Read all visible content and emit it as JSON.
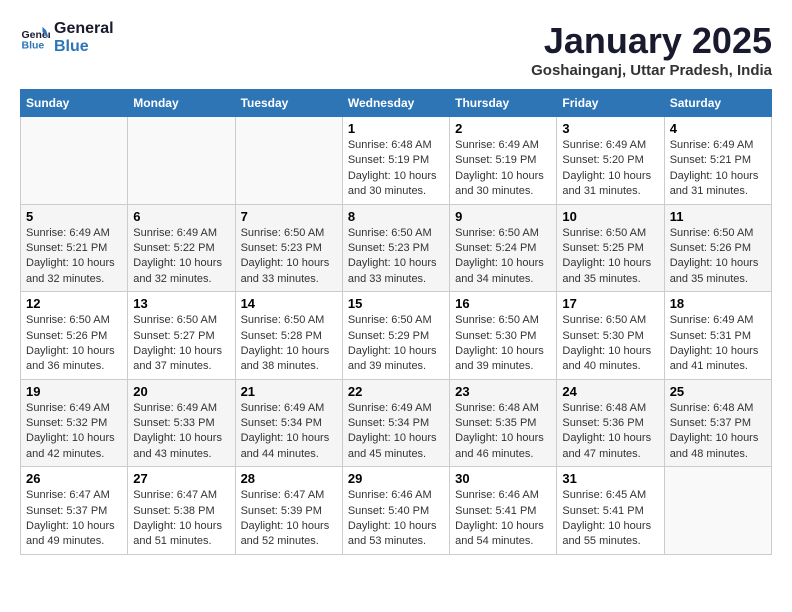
{
  "logo": {
    "line1": "General",
    "line2": "Blue"
  },
  "title": "January 2025",
  "subtitle": "Goshainganj, Uttar Pradesh, India",
  "days_of_week": [
    "Sunday",
    "Monday",
    "Tuesday",
    "Wednesday",
    "Thursday",
    "Friday",
    "Saturday"
  ],
  "weeks": [
    [
      {
        "day": "",
        "info": ""
      },
      {
        "day": "",
        "info": ""
      },
      {
        "day": "",
        "info": ""
      },
      {
        "day": "1",
        "info": "Sunrise: 6:48 AM\nSunset: 5:19 PM\nDaylight: 10 hours and 30 minutes."
      },
      {
        "day": "2",
        "info": "Sunrise: 6:49 AM\nSunset: 5:19 PM\nDaylight: 10 hours and 30 minutes."
      },
      {
        "day": "3",
        "info": "Sunrise: 6:49 AM\nSunset: 5:20 PM\nDaylight: 10 hours and 31 minutes."
      },
      {
        "day": "4",
        "info": "Sunrise: 6:49 AM\nSunset: 5:21 PM\nDaylight: 10 hours and 31 minutes."
      }
    ],
    [
      {
        "day": "5",
        "info": "Sunrise: 6:49 AM\nSunset: 5:21 PM\nDaylight: 10 hours and 32 minutes."
      },
      {
        "day": "6",
        "info": "Sunrise: 6:49 AM\nSunset: 5:22 PM\nDaylight: 10 hours and 32 minutes."
      },
      {
        "day": "7",
        "info": "Sunrise: 6:50 AM\nSunset: 5:23 PM\nDaylight: 10 hours and 33 minutes."
      },
      {
        "day": "8",
        "info": "Sunrise: 6:50 AM\nSunset: 5:23 PM\nDaylight: 10 hours and 33 minutes."
      },
      {
        "day": "9",
        "info": "Sunrise: 6:50 AM\nSunset: 5:24 PM\nDaylight: 10 hours and 34 minutes."
      },
      {
        "day": "10",
        "info": "Sunrise: 6:50 AM\nSunset: 5:25 PM\nDaylight: 10 hours and 35 minutes."
      },
      {
        "day": "11",
        "info": "Sunrise: 6:50 AM\nSunset: 5:26 PM\nDaylight: 10 hours and 35 minutes."
      }
    ],
    [
      {
        "day": "12",
        "info": "Sunrise: 6:50 AM\nSunset: 5:26 PM\nDaylight: 10 hours and 36 minutes."
      },
      {
        "day": "13",
        "info": "Sunrise: 6:50 AM\nSunset: 5:27 PM\nDaylight: 10 hours and 37 minutes."
      },
      {
        "day": "14",
        "info": "Sunrise: 6:50 AM\nSunset: 5:28 PM\nDaylight: 10 hours and 38 minutes."
      },
      {
        "day": "15",
        "info": "Sunrise: 6:50 AM\nSunset: 5:29 PM\nDaylight: 10 hours and 39 minutes."
      },
      {
        "day": "16",
        "info": "Sunrise: 6:50 AM\nSunset: 5:30 PM\nDaylight: 10 hours and 39 minutes."
      },
      {
        "day": "17",
        "info": "Sunrise: 6:50 AM\nSunset: 5:30 PM\nDaylight: 10 hours and 40 minutes."
      },
      {
        "day": "18",
        "info": "Sunrise: 6:49 AM\nSunset: 5:31 PM\nDaylight: 10 hours and 41 minutes."
      }
    ],
    [
      {
        "day": "19",
        "info": "Sunrise: 6:49 AM\nSunset: 5:32 PM\nDaylight: 10 hours and 42 minutes."
      },
      {
        "day": "20",
        "info": "Sunrise: 6:49 AM\nSunset: 5:33 PM\nDaylight: 10 hours and 43 minutes."
      },
      {
        "day": "21",
        "info": "Sunrise: 6:49 AM\nSunset: 5:34 PM\nDaylight: 10 hours and 44 minutes."
      },
      {
        "day": "22",
        "info": "Sunrise: 6:49 AM\nSunset: 5:34 PM\nDaylight: 10 hours and 45 minutes."
      },
      {
        "day": "23",
        "info": "Sunrise: 6:48 AM\nSunset: 5:35 PM\nDaylight: 10 hours and 46 minutes."
      },
      {
        "day": "24",
        "info": "Sunrise: 6:48 AM\nSunset: 5:36 PM\nDaylight: 10 hours and 47 minutes."
      },
      {
        "day": "25",
        "info": "Sunrise: 6:48 AM\nSunset: 5:37 PM\nDaylight: 10 hours and 48 minutes."
      }
    ],
    [
      {
        "day": "26",
        "info": "Sunrise: 6:47 AM\nSunset: 5:37 PM\nDaylight: 10 hours and 49 minutes."
      },
      {
        "day": "27",
        "info": "Sunrise: 6:47 AM\nSunset: 5:38 PM\nDaylight: 10 hours and 51 minutes."
      },
      {
        "day": "28",
        "info": "Sunrise: 6:47 AM\nSunset: 5:39 PM\nDaylight: 10 hours and 52 minutes."
      },
      {
        "day": "29",
        "info": "Sunrise: 6:46 AM\nSunset: 5:40 PM\nDaylight: 10 hours and 53 minutes."
      },
      {
        "day": "30",
        "info": "Sunrise: 6:46 AM\nSunset: 5:41 PM\nDaylight: 10 hours and 54 minutes."
      },
      {
        "day": "31",
        "info": "Sunrise: 6:45 AM\nSunset: 5:41 PM\nDaylight: 10 hours and 55 minutes."
      },
      {
        "day": "",
        "info": ""
      }
    ]
  ]
}
